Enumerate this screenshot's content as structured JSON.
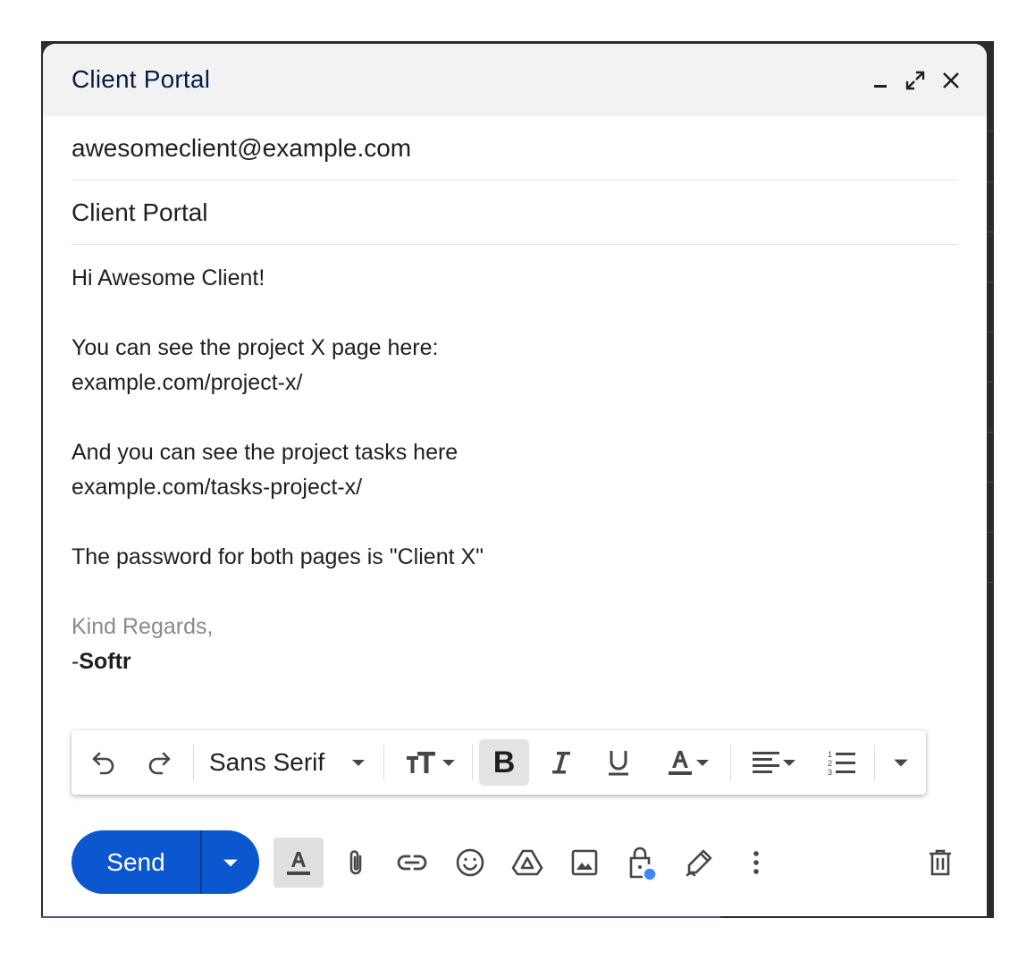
{
  "window": {
    "title": "Client Portal"
  },
  "compose": {
    "to_value": "awesomeclient@example.com",
    "subject_value": "Client Portal",
    "body_lines": [
      "Hi Awesome Client!",
      "",
      "You can see the project X page here:",
      "example.com/project-x/",
      "",
      "And you can see the project tasks here",
      "example.com/tasks-project-x/",
      "",
      "The password for both pages is \"Client X\""
    ],
    "signature_line1": "Kind Regards,",
    "signature_prefix": "-",
    "signature_name": "Softr"
  },
  "format_toolbar": {
    "font_family": "Sans Serif",
    "icons": [
      "undo-icon",
      "redo-icon",
      "font-size-icon",
      "bold-icon",
      "italic-icon",
      "underline-icon",
      "text-color-icon",
      "align-icon",
      "numbered-list-icon",
      "more-formatting-icon"
    ]
  },
  "bottom_toolbar": {
    "send_label": "Send",
    "icons": [
      "formatting-options-icon",
      "attach-icon",
      "link-icon",
      "emoji-icon",
      "drive-icon",
      "image-icon",
      "confidential-mode-icon",
      "signature-icon",
      "more-options-icon",
      "discard-icon"
    ]
  },
  "colors": {
    "send_button": "#0b57d0",
    "title_text": "#041e49",
    "signature_grey": "#8a8a8a",
    "confidential_dot": "#4285f4"
  }
}
